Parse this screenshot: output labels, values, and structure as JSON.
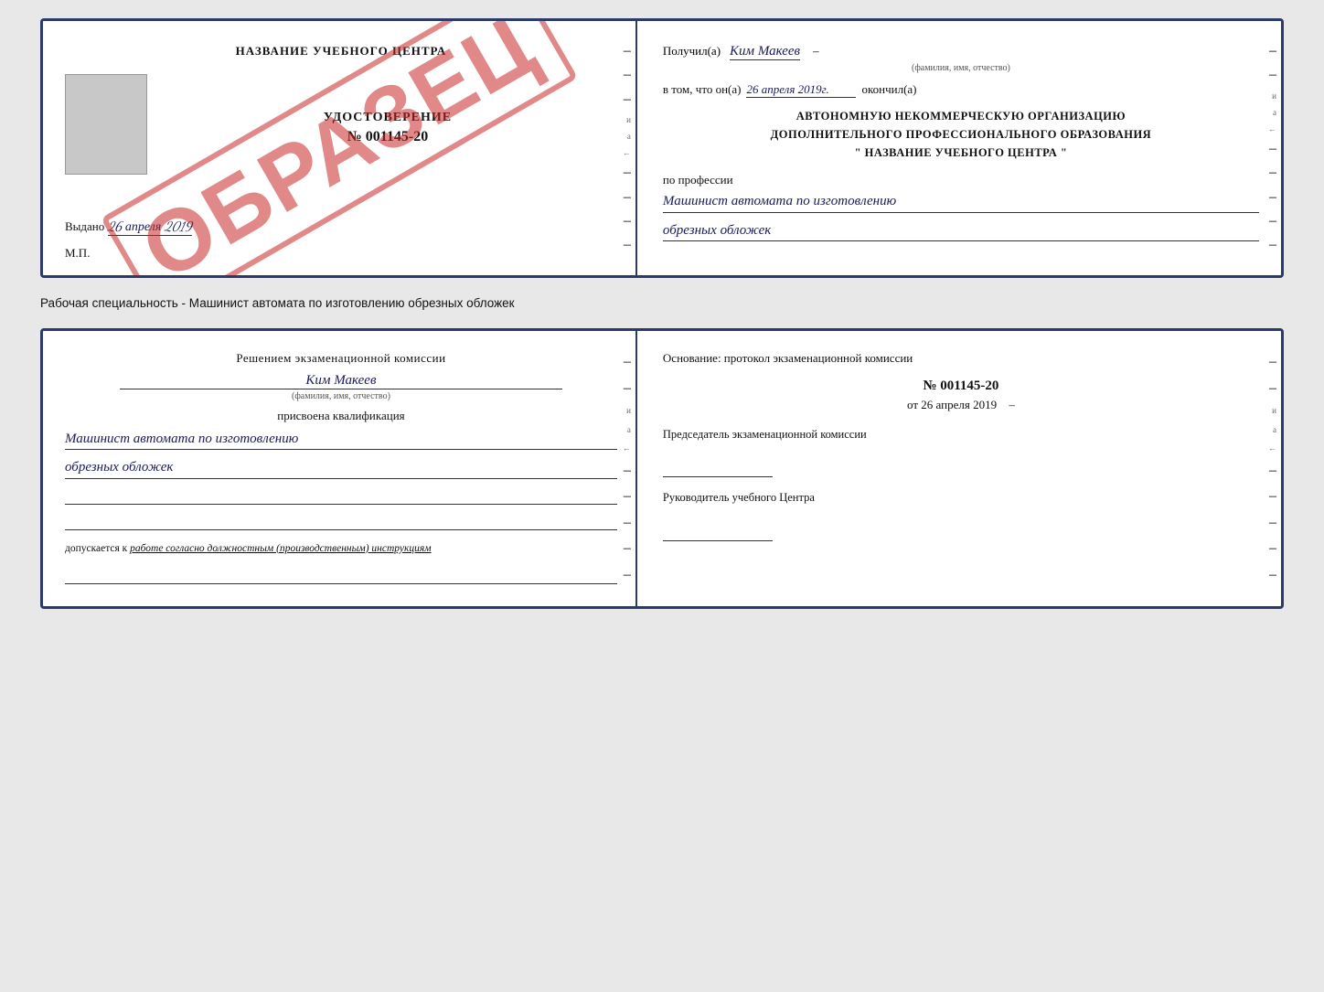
{
  "doc1": {
    "left": {
      "title": "НАЗВАНИЕ УЧЕБНОГО ЦЕНТРА",
      "watermark": "ОБРАЗЕЦ",
      "udostoverenie_label": "УДОСТОВЕРЕНИЕ",
      "number": "№ 001145-20",
      "vydano_label": "Выдано",
      "vydano_date": "26 апреля 2019",
      "mp_label": "М.П."
    },
    "right": {
      "poluchil_prefix": "Получил(а)",
      "poluchil_name": "Ким Макеев",
      "fio_sub": "(фамилия, имя, отчество)",
      "vtom_prefix": "в том, что он(а)",
      "vtom_date": "26 апреля 2019г.",
      "okanchil": "окончил(а)",
      "org_line1": "АВТОНОМНУЮ НЕКОММЕРЧЕСКУЮ ОРГАНИЗАЦИЮ",
      "org_line2": "ДОПОЛНИТЕЛЬНОГО ПРОФЕССИОНАЛЬНОГО ОБРАЗОВАНИЯ",
      "org_quote_open": "\"",
      "org_name": "НАЗВАНИЕ УЧЕБНОГО ЦЕНТРА",
      "org_quote_close": "\"",
      "profession_label": "по профессии",
      "profession_line1": "Машинист автомата по изготовлению",
      "profession_line2": "обрезных обложек"
    }
  },
  "separator": "Рабочая специальность - Машинист автомата по изготовлению обрезных обложек",
  "doc2": {
    "left": {
      "resheniem_line1": "Решением экзаменационной комиссии",
      "person_name": "Ким Макеев",
      "fio_sub": "(фамилия, имя, отчество)",
      "prisvoena_label": "присвоена квалификация",
      "kvali_line1": "Машинист автомата по изготовлению",
      "kvali_line2": "обрезных обложек",
      "dopusk_prefix": "допускается к",
      "dopusk_text": "работе согласно должностным (производственным) инструкциям"
    },
    "right": {
      "osnovanie_text": "Основание: протокол экзаменационной комиссии",
      "protocol_number": "№  001145-20",
      "protocol_date_prefix": "от",
      "protocol_date": "26 апреля 2019",
      "predsedatel_label": "Председатель экзаменационной комиссии",
      "rukovoditel_label": "Руководитель учебного Центра"
    }
  }
}
